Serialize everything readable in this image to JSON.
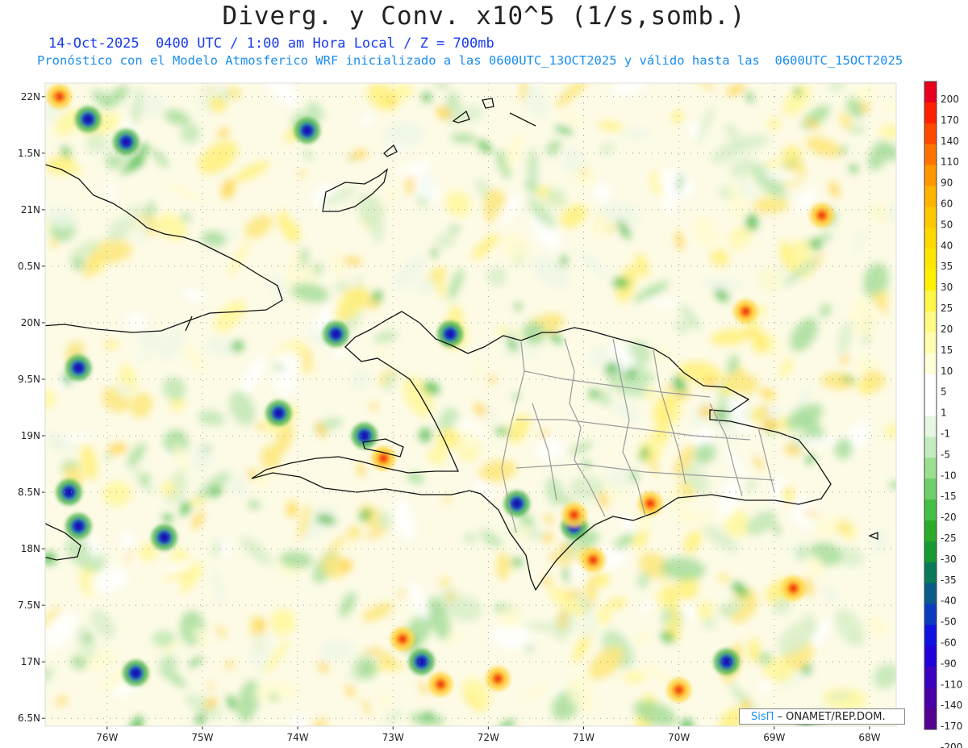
{
  "header": {
    "title": "Diverg. y Conv. x10^5 (1/s,somb.)",
    "subtitle": "14-Oct-2025  0400 UTC / 1:00 am Hora Local / Z = 700mb",
    "description": "Pronóstico con el Modelo Atmosferico WRF inicializado a las 0600UTC_13OCT2025 y válido hasta las  0600UTC_15OCT2025"
  },
  "map": {
    "lon_range": [
      -76.65,
      -67.72
    ],
    "lat_range": [
      16.43,
      22.12
    ],
    "lat_ticks": [
      {
        "value": 22,
        "label": "22N"
      },
      {
        "value": 21.5,
        "label": "1.5N"
      },
      {
        "value": 21,
        "label": "21N"
      },
      {
        "value": 20.5,
        "label": "0.5N"
      },
      {
        "value": 20,
        "label": "20N"
      },
      {
        "value": 19.5,
        "label": "9.5N"
      },
      {
        "value": 19,
        "label": "19N"
      },
      {
        "value": 18.5,
        "label": "8.5N"
      },
      {
        "value": 18,
        "label": "18N"
      },
      {
        "value": 17.5,
        "label": "7.5N"
      },
      {
        "value": 17,
        "label": "17N"
      },
      {
        "value": 16.5,
        "label": "6.5N"
      }
    ],
    "lon_ticks": [
      {
        "value": -76,
        "label": "76W"
      },
      {
        "value": -75,
        "label": "75W"
      },
      {
        "value": -74,
        "label": "74W"
      },
      {
        "value": -73,
        "label": "73W"
      },
      {
        "value": -72,
        "label": "72W"
      },
      {
        "value": -71,
        "label": "71W"
      },
      {
        "value": -70,
        "label": "70W"
      },
      {
        "value": -69,
        "label": "69W"
      },
      {
        "value": -68,
        "label": "68W"
      }
    ],
    "grid": "dotted",
    "field": "divergence_convergence_700mb",
    "convergence_cores": [
      {
        "lon": -76.2,
        "lat": 21.8
      },
      {
        "lon": -75.8,
        "lat": 21.6
      },
      {
        "lon": -73.9,
        "lat": 21.7
      },
      {
        "lon": -72.4,
        "lat": 19.9
      },
      {
        "lon": -73.3,
        "lat": 19.0
      },
      {
        "lon": -73.6,
        "lat": 19.9
      },
      {
        "lon": -74.2,
        "lat": 19.2
      },
      {
        "lon": -76.3,
        "lat": 18.2
      },
      {
        "lon": -75.4,
        "lat": 18.1
      },
      {
        "lon": -76.4,
        "lat": 18.5
      },
      {
        "lon": -71.1,
        "lat": 18.2
      },
      {
        "lon": -76.3,
        "lat": 19.6
      },
      {
        "lon": -75.7,
        "lat": 16.9
      },
      {
        "lon": -69.5,
        "lat": 17.0
      },
      {
        "lon": -71.7,
        "lat": 18.4
      },
      {
        "lon": -72.7,
        "lat": 17.0
      }
    ],
    "divergence_cores": [
      {
        "lon": -70.0,
        "lat": 16.75
      },
      {
        "lon": -68.8,
        "lat": 17.65
      },
      {
        "lon": -68.5,
        "lat": 20.95
      },
      {
        "lon": -69.3,
        "lat": 20.1
      },
      {
        "lon": -70.3,
        "lat": 18.4
      },
      {
        "lon": -72.9,
        "lat": 17.2
      },
      {
        "lon": -72.5,
        "lat": 16.8
      },
      {
        "lon": -73.1,
        "lat": 18.8
      },
      {
        "lon": -76.5,
        "lat": 22.0
      },
      {
        "lon": -71.9,
        "lat": 16.85
      },
      {
        "lon": -71.1,
        "lat": 18.3
      },
      {
        "lon": -70.9,
        "lat": 17.9
      }
    ]
  },
  "colorbar": {
    "labels": [
      "200",
      "170",
      "140",
      "110",
      "90",
      "60",
      "50",
      "40",
      "35",
      "30",
      "25",
      "20",
      "15",
      "10",
      "5",
      "1",
      "-1",
      "-5",
      "-10",
      "-15",
      "-20",
      "-25",
      "-30",
      "-35",
      "-40",
      "-50",
      "-60",
      "-90",
      "-110",
      "-140",
      "-170",
      "-200"
    ],
    "colors": [
      "#e8001c",
      "#ff2000",
      "#ff4a00",
      "#ff7400",
      "#ff9800",
      "#ffb400",
      "#ffc800",
      "#ffd800",
      "#ffe600",
      "#fff000",
      "#fff64a",
      "#fffa84",
      "#fffcb0",
      "#fffed8",
      "#ffffff",
      "#ffffff",
      "#e6f6e0",
      "#c4ecc0",
      "#9ae090",
      "#6ed068",
      "#44c044",
      "#2aac2a",
      "#169a34",
      "#0a7a5a",
      "#0a5a8a",
      "#0a3cc0",
      "#1010e0",
      "#2000d8",
      "#3c00c0",
      "#4a00a8",
      "#540090"
    ]
  },
  "credit": {
    "brand": "SisΠ",
    "text": " – ONAMET/REP.DOM."
  }
}
